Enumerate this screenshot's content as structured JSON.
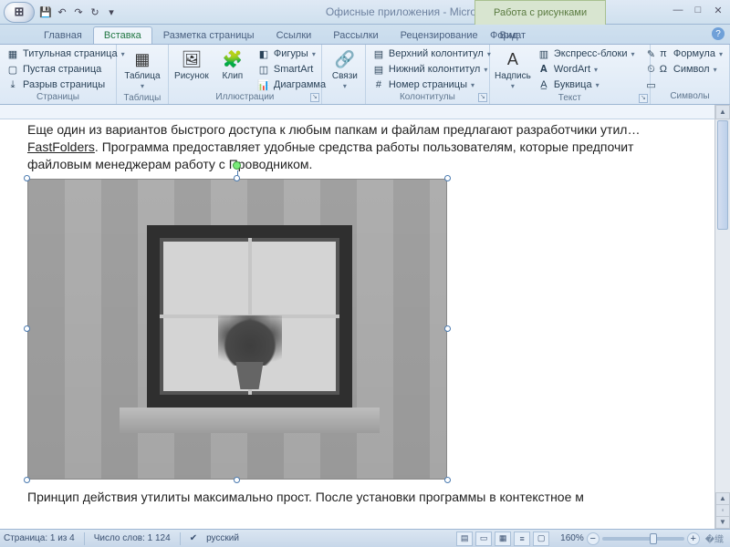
{
  "title": "Офисные приложения - Microsoft Word",
  "context_tab": "Работа с рисунками",
  "qat_icons": [
    "save-icon",
    "undo-icon",
    "redo-icon",
    "repeat-icon",
    "qat-more-icon"
  ],
  "tabs": [
    "Главная",
    "Вставка",
    "Разметка страницы",
    "Ссылки",
    "Рассылки",
    "Рецензирование",
    "Вид"
  ],
  "active_tab_index": 1,
  "format_tab": "Формат",
  "ribbon": {
    "pages": {
      "label": "Страницы",
      "items": [
        "Титульная страница",
        "Пустая страница",
        "Разрыв страницы"
      ]
    },
    "tables": {
      "label": "Таблицы",
      "btn": "Таблица"
    },
    "illustr": {
      "label": "Иллюстрации",
      "big": [
        "Рисунок",
        "Клип"
      ],
      "small": [
        "Фигуры",
        "SmartArt",
        "Диаграмма"
      ]
    },
    "links": {
      "label": " ",
      "btn": "Связи"
    },
    "headfoot": {
      "label": "Колонтитулы",
      "items": [
        "Верхний колонтитул",
        "Нижний колонтитул",
        "Номер страницы"
      ]
    },
    "text": {
      "label": "Текст",
      "big": "Надпись",
      "small": [
        "Экспресс-блоки",
        "WordArt",
        "Буквица"
      ]
    },
    "symbols": {
      "label": "Символы",
      "items": [
        "Формула",
        "Символ"
      ]
    }
  },
  "doc": {
    "p1a": "Еще один из вариантов быстрого доступа к любым папкам и файлам предлагают разработчики утил…",
    "p1b": "FastFolders",
    "p1c": ". Программа предоставляет удобные средства работы пользователям, которые предпочит",
    "p1d": "файловым менеджерам работу с Проводником.",
    "p2": "Принцип действия утилиты максимально прост. После установки программы в контекстное м"
  },
  "status": {
    "page": "Страница: 1 из 4",
    "words": "Число слов: 1 124",
    "lang": "русский",
    "zoom": "160%"
  },
  "scroll": {
    "up": "▲",
    "down": "▼",
    "prev": "▲",
    "sel": "◦",
    "next": "▼"
  }
}
